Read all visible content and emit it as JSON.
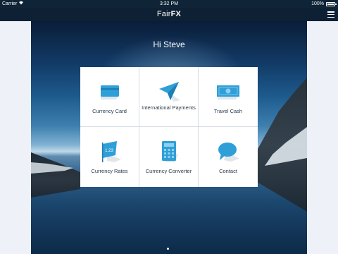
{
  "status_bar": {
    "carrier": "Carrier",
    "time": "3:32 PM",
    "battery": "100%"
  },
  "navbar": {
    "logo_prefix": "Fair",
    "logo_suffix": "FX",
    "menu_icon": "hamburger-menu-icon"
  },
  "greeting": "Hi Steve",
  "tiles": [
    {
      "label": "Currency Card",
      "icon": "credit-card-icon",
      "color": "#2f9fd8"
    },
    {
      "label": "International Payments",
      "icon": "paper-plane-icon",
      "color": "#2f9fd8"
    },
    {
      "label": "Travel Cash",
      "icon": "banknote-icon",
      "color": "#2f9fd8"
    },
    {
      "label": "Currency Rates",
      "icon": "rates-flag-icon",
      "color": "#2f9fd8"
    },
    {
      "label": "Currency Converter",
      "icon": "calculator-icon",
      "color": "#2f9fd8"
    },
    {
      "label": "Contact",
      "icon": "chat-bubble-icon",
      "color": "#2f9fd8"
    }
  ],
  "rates_icon_text": "1.23",
  "colors": {
    "navbar": "#0e2134",
    "accent": "#2f9fd8",
    "tile_bg": "#ffffff",
    "tile_text": "#2a3a4a"
  }
}
